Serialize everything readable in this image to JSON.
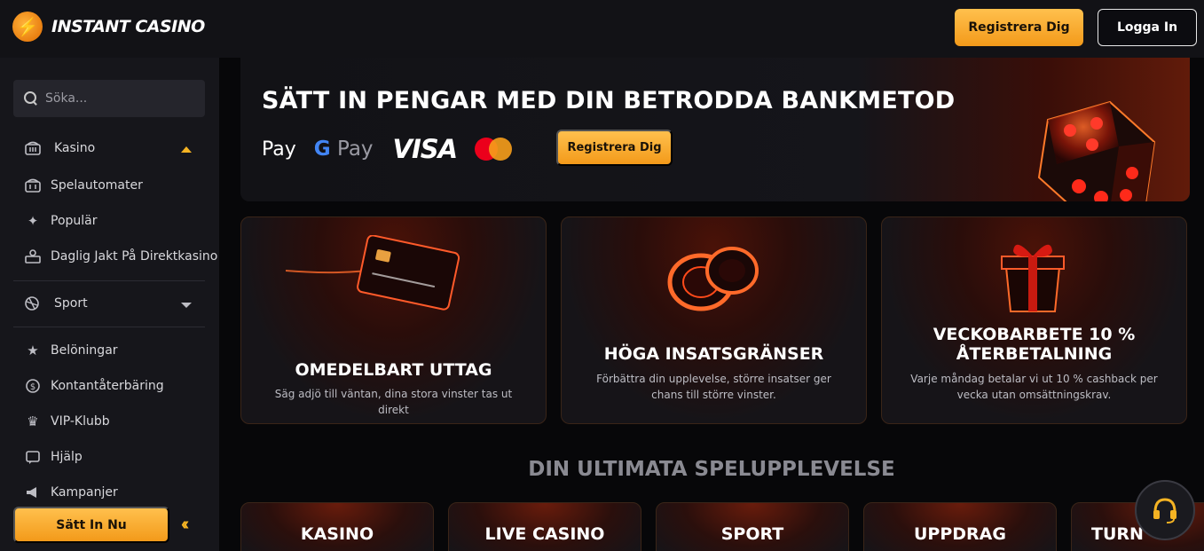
{
  "header": {
    "brand": "INSTANT CASINO",
    "register_label": "Registrera Dig",
    "login_label": "Logga In"
  },
  "sidebar": {
    "search_placeholder": "Söka...",
    "items": [
      {
        "label": "Kasino",
        "icon": "casino-icon"
      },
      {
        "label": "Spelautomater",
        "icon": "slot-machine-icon"
      },
      {
        "label": "Populär",
        "icon": "sparkle-icon"
      },
      {
        "label": "Daglig Jakt På Direktkasino",
        "icon": "live-casino-icon"
      },
      {
        "label": "Sport",
        "icon": "sport-icon"
      },
      {
        "label": "Belöningar",
        "icon": "star-icon"
      },
      {
        "label": "Kontantåterbäring",
        "icon": "cashback-icon"
      },
      {
        "label": "VIP-Klubb",
        "icon": "crown-icon"
      },
      {
        "label": "Hjälp",
        "icon": "help-icon"
      },
      {
        "label": "Kampanjer",
        "icon": "megaphone-icon"
      }
    ],
    "deposit_label": "Sätt In Nu"
  },
  "banner": {
    "title": "SÄTT IN PENGAR MED DIN BETRODDA BANKMETOD",
    "apple_pay": "Pay",
    "google_g": "G",
    "google_pay": "Pay",
    "visa": "VISA",
    "register_label": "Registrera Dig"
  },
  "features": [
    {
      "title": "OMEDELBART UTTAG",
      "desc": "Säg adjö till väntan, dina stora vinster tas ut direkt"
    },
    {
      "title": "HÖGA INSATSGRÄNSER",
      "desc": "Förbättra din upplevelse, större insatser ger chans till större vinster."
    },
    {
      "title": "VECKOBARBETE 10 % ÅTERBETALNING",
      "desc": "Varje måndag betalar vi ut 10 % cashback per vecka utan omsättningskrav."
    }
  ],
  "section_title": "DIN ULTIMATA SPELUPPLEVELSE",
  "categories": [
    "KASINO",
    "LIVE CASINO",
    "SPORT",
    "UPPDRAG",
    "TURN"
  ],
  "colors": {
    "accent": "#f5b323",
    "background": "#070709",
    "sidebar": "#16161b"
  }
}
